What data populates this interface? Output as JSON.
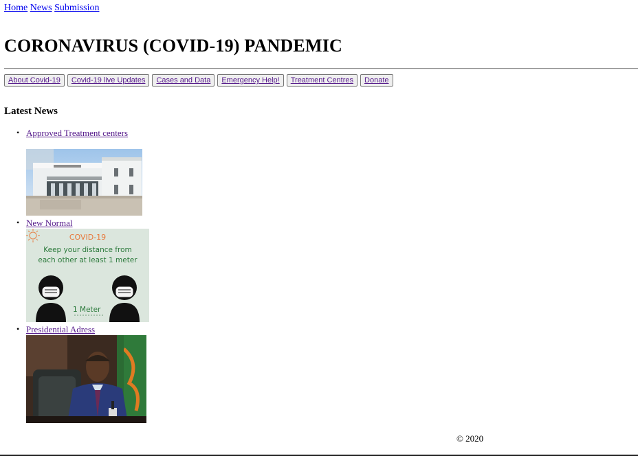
{
  "top_nav": {
    "home": "Home",
    "news": "News",
    "submission": "Submission"
  },
  "page_title": "CORONAVIRUS (COVID-19) PANDEMIC",
  "buttons": [
    "About Covid-19",
    "Covid-19 live Updates",
    "Cases and Data",
    "Emergency Help!",
    "Treatment Centres",
    "Donate"
  ],
  "section_heading": "Latest News",
  "news": [
    {
      "label": "Approved Treatment centers"
    },
    {
      "label": "New Normal",
      "poster": {
        "title": "COVID-19",
        "line1": "Keep your distance from",
        "line2": "each other at least 1 meter",
        "distance": "1 Meter"
      }
    },
    {
      "label": "Presidential Adress"
    }
  ],
  "footer": "© 2020",
  "colors": {
    "link": "#0000ee",
    "visited": "#551a8b",
    "poster_bg": "#dbe6dd",
    "poster_orange": "#e8773a",
    "poster_green": "#2c7a3c"
  }
}
